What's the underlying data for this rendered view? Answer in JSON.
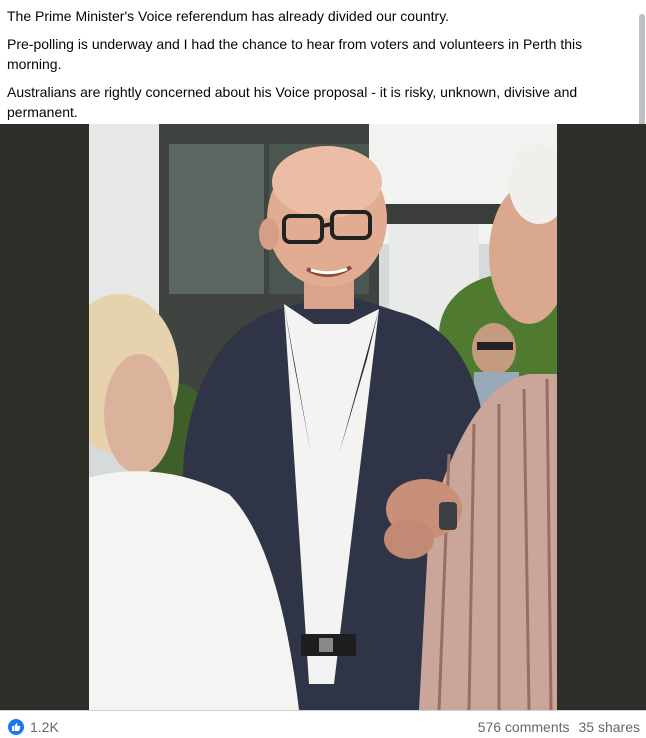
{
  "post": {
    "paragraphs": [
      "The Prime Minister's Voice referendum has already divided our country.",
      "Pre-polling is underway and I had the chance to hear from voters and volunteers in Perth this morning.",
      "Australians are rightly concerned about his Voice proposal - it is risky, unknown, divisive and permanent."
    ]
  },
  "reactions": {
    "icon": "thumbs-up-icon",
    "count": "1.2K"
  },
  "engagement": {
    "comments": "576 comments",
    "shares": "35 shares"
  },
  "colors": {
    "like_blue": "#1877f2",
    "muted_text": "#65676b",
    "photo_frame": "#2e2f29"
  }
}
